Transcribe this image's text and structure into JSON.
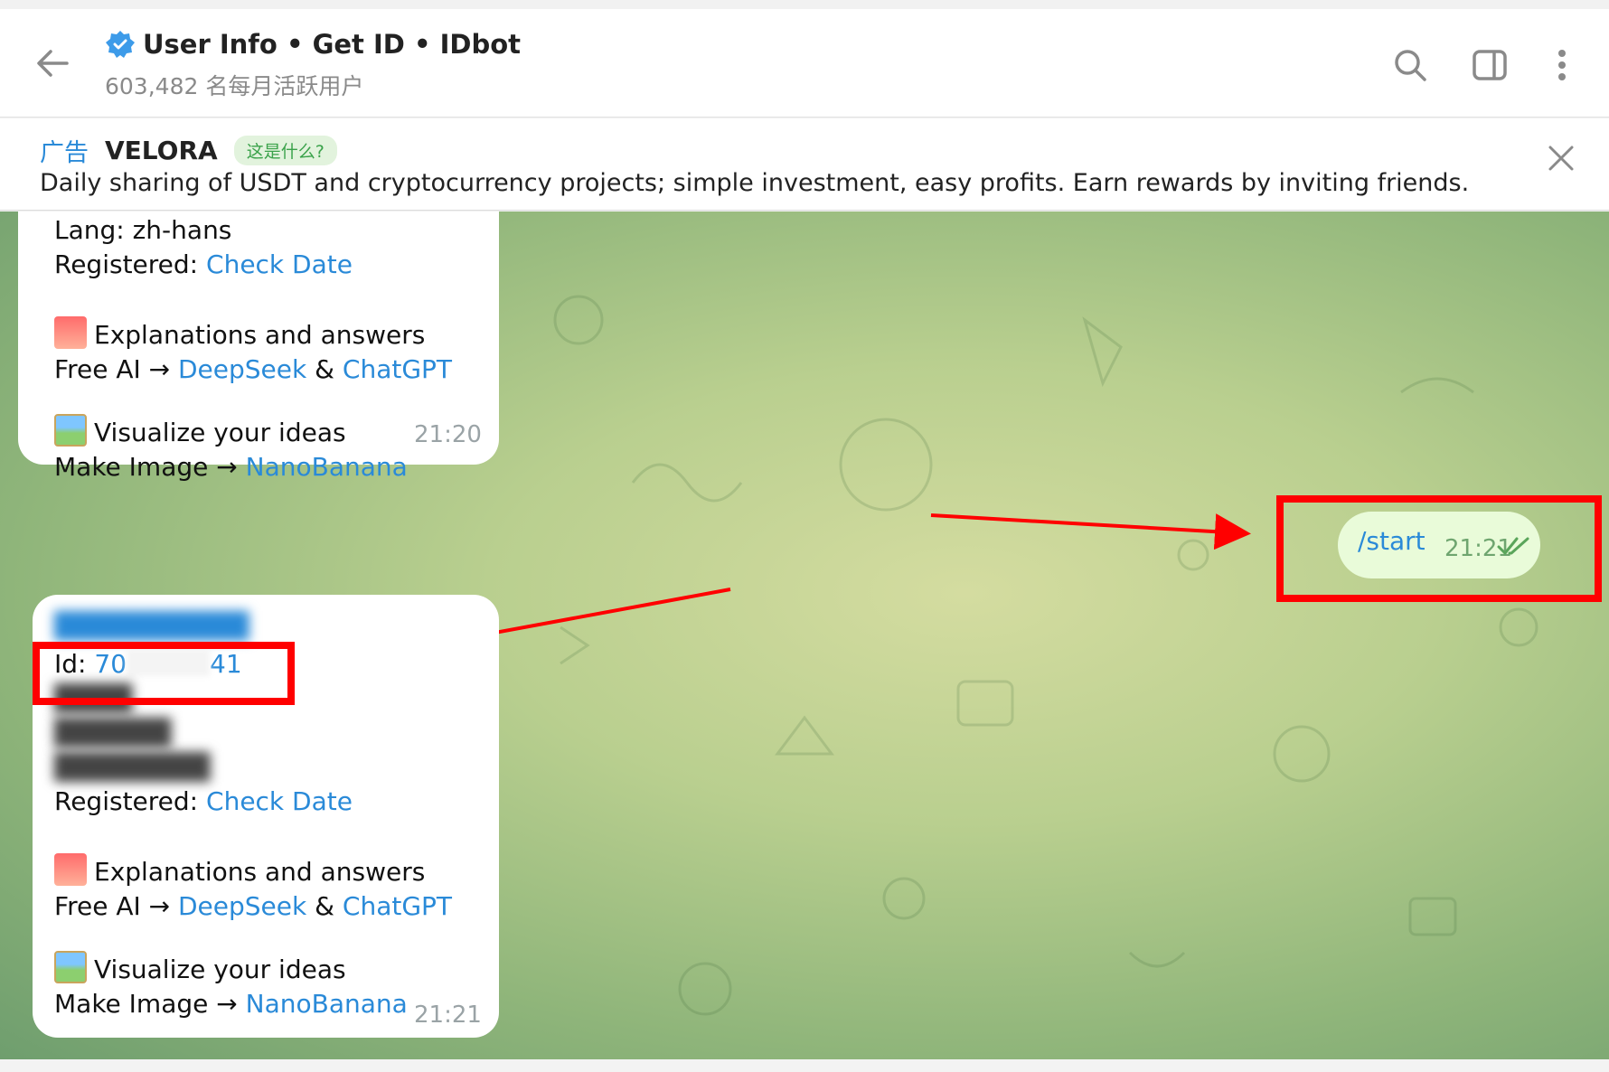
{
  "header": {
    "title": "User Info • Get ID • IDbot",
    "subtitle": "603,482 名每月活跃用户"
  },
  "ad": {
    "label": "广告",
    "brand": "VELORA",
    "what_label": "这是什么?",
    "text": "Daily sharing of USDT and cryptocurrency projects; simple investment, easy profits. Earn rewards by inviting friends."
  },
  "messages": {
    "first": {
      "lang": "Lang: zh-hans",
      "registered_label": "Registered:",
      "registered_link": "Check Date",
      "explain_title": "Explanations and answers",
      "ai_prefix": "Free AI →",
      "ai_link1": "DeepSeek",
      "ai_amp": "&",
      "ai_link2": "ChatGPT",
      "visualize_title": "Visualize your ideas",
      "image_prefix": "Make Image →",
      "image_link": "NanoBanana",
      "time": "21:20"
    },
    "outgoing": {
      "text": "/start",
      "time": "21:21"
    },
    "second": {
      "id_label": "Id:",
      "id_start": "70",
      "id_end": "41",
      "registered_label": "Registered:",
      "registered_link": "Check Date",
      "explain_title": "Explanations and answers",
      "ai_prefix": "Free AI →",
      "ai_link1": "DeepSeek",
      "ai_amp": "&",
      "ai_link2": "ChatGPT",
      "visualize_title": "Visualize your ideas",
      "image_prefix": "Make Image →",
      "image_link": "NanoBanana",
      "time": "21:21"
    }
  },
  "colors": {
    "accent": "#2a8ad8",
    "highlight": "#ff0000",
    "outgoing_bubble": "#e9fbd9"
  }
}
